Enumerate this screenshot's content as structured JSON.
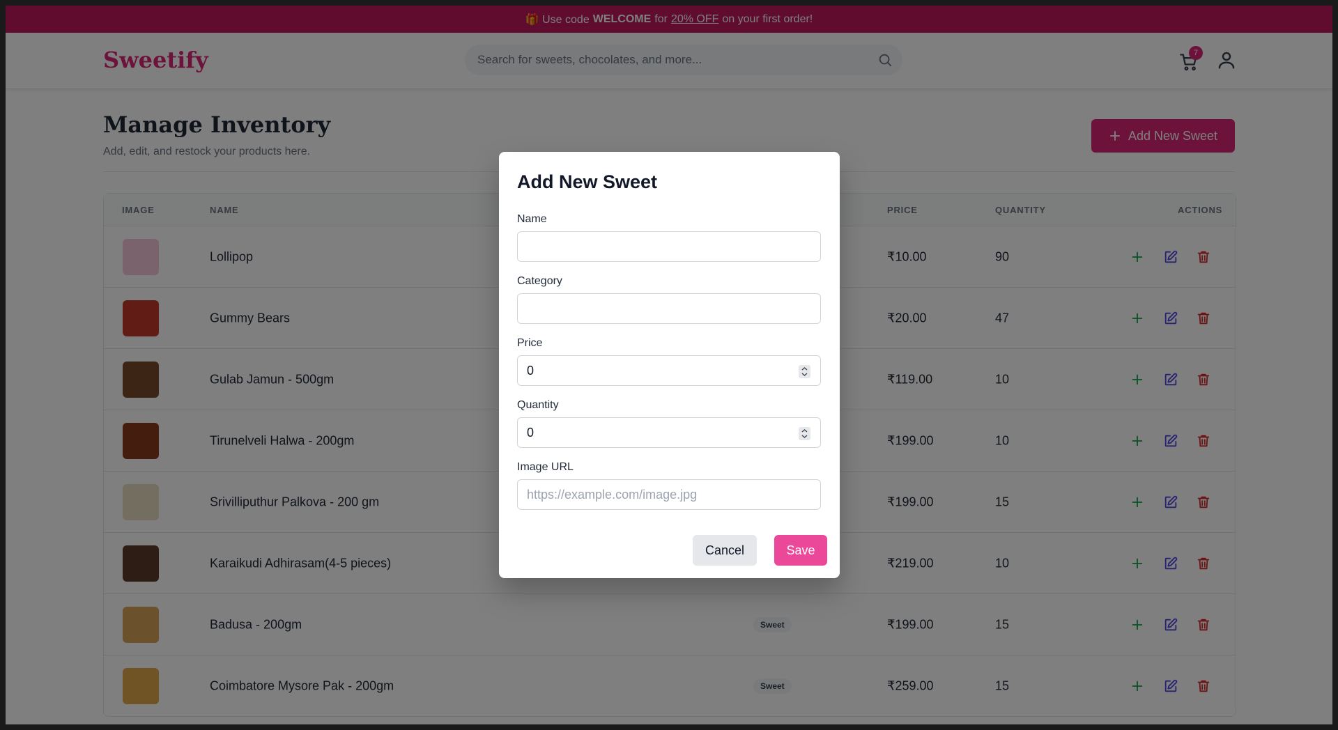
{
  "promo": {
    "prefix": "🎁 Use code",
    "code": "WELCOME",
    "middle": "for",
    "discount": "20% OFF",
    "suffix": "on your first order!"
  },
  "header": {
    "logo": "Sweetify",
    "search_placeholder": "Search for sweets, chocolates, and more...",
    "cart_count": "7"
  },
  "page": {
    "title": "Manage Inventory",
    "subtitle": "Add, edit, and restock your products here.",
    "add_button": "Add New Sweet"
  },
  "table": {
    "headers": {
      "image": "IMAGE",
      "name": "NAME",
      "price": "PRICE",
      "quantity": "QUANTITY",
      "actions": "ACTIONS"
    },
    "rows": [
      {
        "name": "Lollipop",
        "category": "",
        "price": "₹10.00",
        "quantity": "90",
        "thumb_color": "#f4c7d8"
      },
      {
        "name": "Gummy Bears",
        "category": "",
        "price": "₹20.00",
        "quantity": "47",
        "thumb_color": "#c0392b"
      },
      {
        "name": "Gulab Jamun - 500gm",
        "category": "",
        "price": "₹119.00",
        "quantity": "10",
        "thumb_color": "#7a4a2a"
      },
      {
        "name": "Tirunelveli Halwa - 200gm",
        "category": "",
        "price": "₹199.00",
        "quantity": "10",
        "thumb_color": "#8b3a1e"
      },
      {
        "name": "Srivilliputhur Palkova - 200 gm",
        "category": "",
        "price": "₹199.00",
        "quantity": "15",
        "thumb_color": "#e8dcc0"
      },
      {
        "name": "Karaikudi Adhirasam(4-5 pieces)",
        "category": "",
        "price": "₹219.00",
        "quantity": "10",
        "thumb_color": "#5a3a2a"
      },
      {
        "name": "Badusa - 200gm",
        "category": "Sweet",
        "price": "₹199.00",
        "quantity": "15",
        "thumb_color": "#d9a35a"
      },
      {
        "name": "Coimbatore Mysore Pak - 200gm",
        "category": "Sweet",
        "price": "₹259.00",
        "quantity": "15",
        "thumb_color": "#e0a84a"
      }
    ]
  },
  "modal": {
    "title": "Add New Sweet",
    "name_label": "Name",
    "name_value": "",
    "category_label": "Category",
    "category_value": "",
    "price_label": "Price",
    "price_value": "0",
    "quantity_label": "Quantity",
    "quantity_value": "0",
    "image_label": "Image URL",
    "image_placeholder": "https://example.com/image.jpg",
    "cancel": "Cancel",
    "save": "Save"
  },
  "colors": {
    "brand": "#db2777",
    "promo_bg": "#be185d",
    "plus": "#16a34a",
    "edit": "#4f46e5",
    "delete": "#dc2626"
  },
  "icons": {
    "search": "search-icon",
    "cart": "cart-icon",
    "user": "user-icon",
    "plus": "plus-icon",
    "edit": "edit-icon",
    "delete": "trash-icon"
  }
}
